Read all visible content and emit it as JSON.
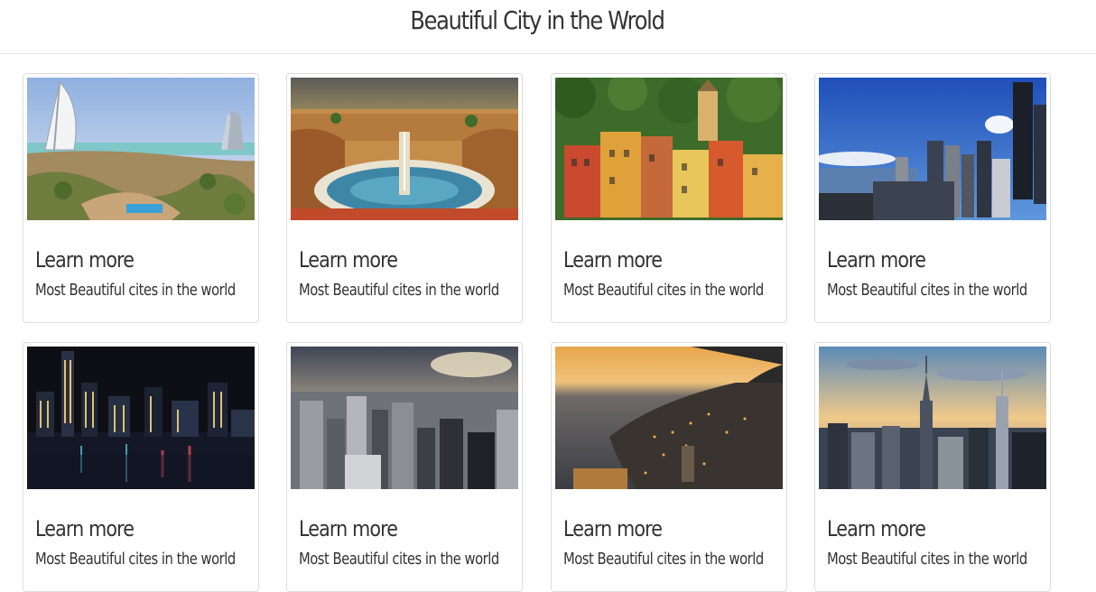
{
  "header": {
    "title": "Beautiful City in the Wrold"
  },
  "cards": [
    {
      "title": "Learn more",
      "subtitle": "Most Beautiful cites in the world",
      "image": "dubai-burj-al-arab"
    },
    {
      "title": "Learn more",
      "subtitle": "Most Beautiful cites in the world",
      "image": "vatican-st-peters-square"
    },
    {
      "title": "Learn more",
      "subtitle": "Most Beautiful cites in the world",
      "image": "portofino-colorful-houses"
    },
    {
      "title": "Learn more",
      "subtitle": "Most Beautiful cites in the world",
      "image": "seattle-skyline"
    },
    {
      "title": "Learn more",
      "subtitle": "Most Beautiful cites in the world",
      "image": "hong-kong-night"
    },
    {
      "title": "Learn more",
      "subtitle": "Most Beautiful cites in the world",
      "image": "manhattan-aerial"
    },
    {
      "title": "Learn more",
      "subtitle": "Most Beautiful cites in the world",
      "image": "monaco-coast-dusk"
    },
    {
      "title": "Learn more",
      "subtitle": "Most Beautiful cites in the world",
      "image": "new-york-empire-state"
    }
  ]
}
